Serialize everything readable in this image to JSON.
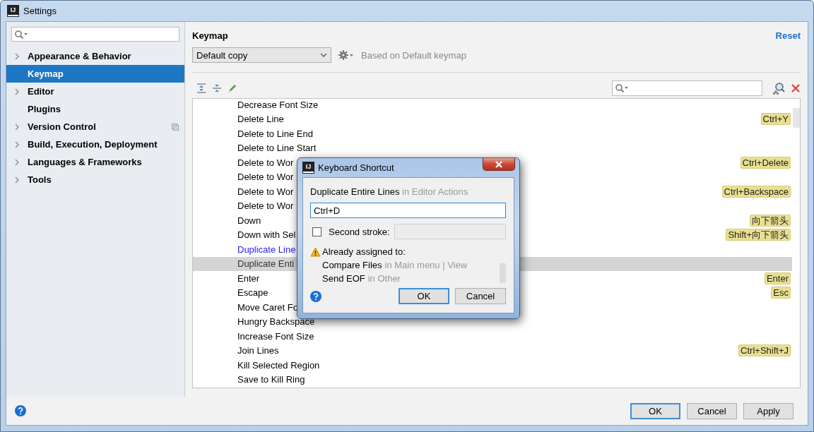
{
  "window": {
    "logo": "IJ",
    "title": "Settings"
  },
  "sidebar": {
    "items": [
      {
        "label": "Appearance & Behavior",
        "expandable": true,
        "selected": false,
        "scope_icon": false
      },
      {
        "label": "Keymap",
        "expandable": false,
        "selected": true,
        "scope_icon": false
      },
      {
        "label": "Editor",
        "expandable": true,
        "selected": false,
        "scope_icon": false
      },
      {
        "label": "Plugins",
        "expandable": false,
        "selected": false,
        "scope_icon": false
      },
      {
        "label": "Version Control",
        "expandable": true,
        "selected": false,
        "scope_icon": true
      },
      {
        "label": "Build, Execution, Deployment",
        "expandable": true,
        "selected": false,
        "scope_icon": false
      },
      {
        "label": "Languages & Frameworks",
        "expandable": true,
        "selected": false,
        "scope_icon": false
      },
      {
        "label": "Tools",
        "expandable": true,
        "selected": false,
        "scope_icon": false
      }
    ]
  },
  "keymap": {
    "title": "Keymap",
    "reset": "Reset",
    "scheme": "Default copy",
    "based_on": "Based on Default keymap",
    "actions": [
      {
        "name": "Decrease Font Size",
        "modified": false,
        "selected": false
      },
      {
        "name": "Delete Line",
        "shortcut": "Ctrl+Y",
        "modified": false,
        "selected": false
      },
      {
        "name": "Delete to Line End",
        "modified": false,
        "selected": false
      },
      {
        "name": "Delete to Line Start",
        "modified": false,
        "selected": false
      },
      {
        "name": "Delete to Wor",
        "shortcut": "Ctrl+Delete",
        "modified": false,
        "selected": false
      },
      {
        "name": "Delete to Wor",
        "modified": false,
        "selected": false
      },
      {
        "name": "Delete to Wor",
        "shortcut": "Ctrl+Backspace",
        "modified": false,
        "selected": false
      },
      {
        "name": "Delete to Wor",
        "modified": false,
        "selected": false
      },
      {
        "name": "Down",
        "shortcut": "向下箭头",
        "modified": false,
        "selected": false
      },
      {
        "name": "Down with Sel",
        "shortcut": "Shift+向下箭头",
        "modified": false,
        "selected": false
      },
      {
        "name": "Duplicate Line",
        "modified": true,
        "selected": false
      },
      {
        "name": "Duplicate Enti",
        "modified": false,
        "selected": true
      },
      {
        "name": "Enter",
        "shortcut": "Enter",
        "modified": false,
        "selected": false
      },
      {
        "name": "Escape",
        "shortcut": "Esc",
        "modified": false,
        "selected": false
      },
      {
        "name": "Move Caret Fo",
        "modified": false,
        "selected": false
      },
      {
        "name": "Hungry Backspace",
        "modified": false,
        "selected": false
      },
      {
        "name": "Increase Font Size",
        "modified": false,
        "selected": false
      },
      {
        "name": "Join Lines",
        "shortcut": "Ctrl+Shift+J",
        "modified": false,
        "selected": false
      },
      {
        "name": "Kill Selected Region",
        "modified": false,
        "selected": false
      },
      {
        "name": "Save to Kill Ring",
        "modified": false,
        "selected": false
      }
    ]
  },
  "dialog": {
    "logo": "IJ",
    "title": "Keyboard Shortcut",
    "action": "Duplicate Entire Lines",
    "action_context": "in Editor Actions",
    "shortcut": "Ctrl+D",
    "second_stroke": {
      "label": "Second stroke:",
      "checked": false
    },
    "warning": "Already assigned to:",
    "assigned": [
      {
        "name": "Compare Files",
        "context": "in Main menu | View"
      },
      {
        "name": "Send EOF",
        "context": "in Other"
      }
    ],
    "buttons": [
      "OK",
      "Cancel"
    ]
  },
  "buttons": [
    "OK",
    "Cancel",
    "Apply"
  ]
}
